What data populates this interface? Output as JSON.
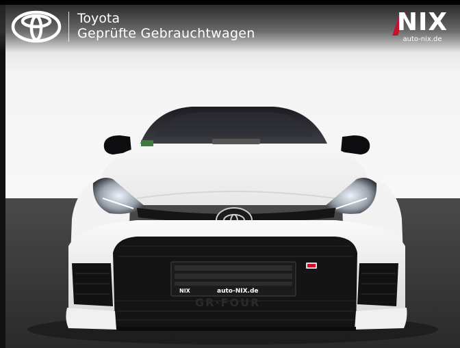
{
  "header": {
    "brand_name": "Toyota",
    "brand_tagline": "Geprüfte Gebrauchtwagen",
    "logo_icon": "toyota-logo-icon"
  },
  "dealer": {
    "name": "NIX",
    "url": "auto-nix.de",
    "accent_color": "#c8102e"
  },
  "license_plate": {
    "left_text": "NIX",
    "center_text": "auto-NIX.de"
  },
  "photo": {
    "subject": "car-front",
    "body_color": "#f2f2f2"
  }
}
